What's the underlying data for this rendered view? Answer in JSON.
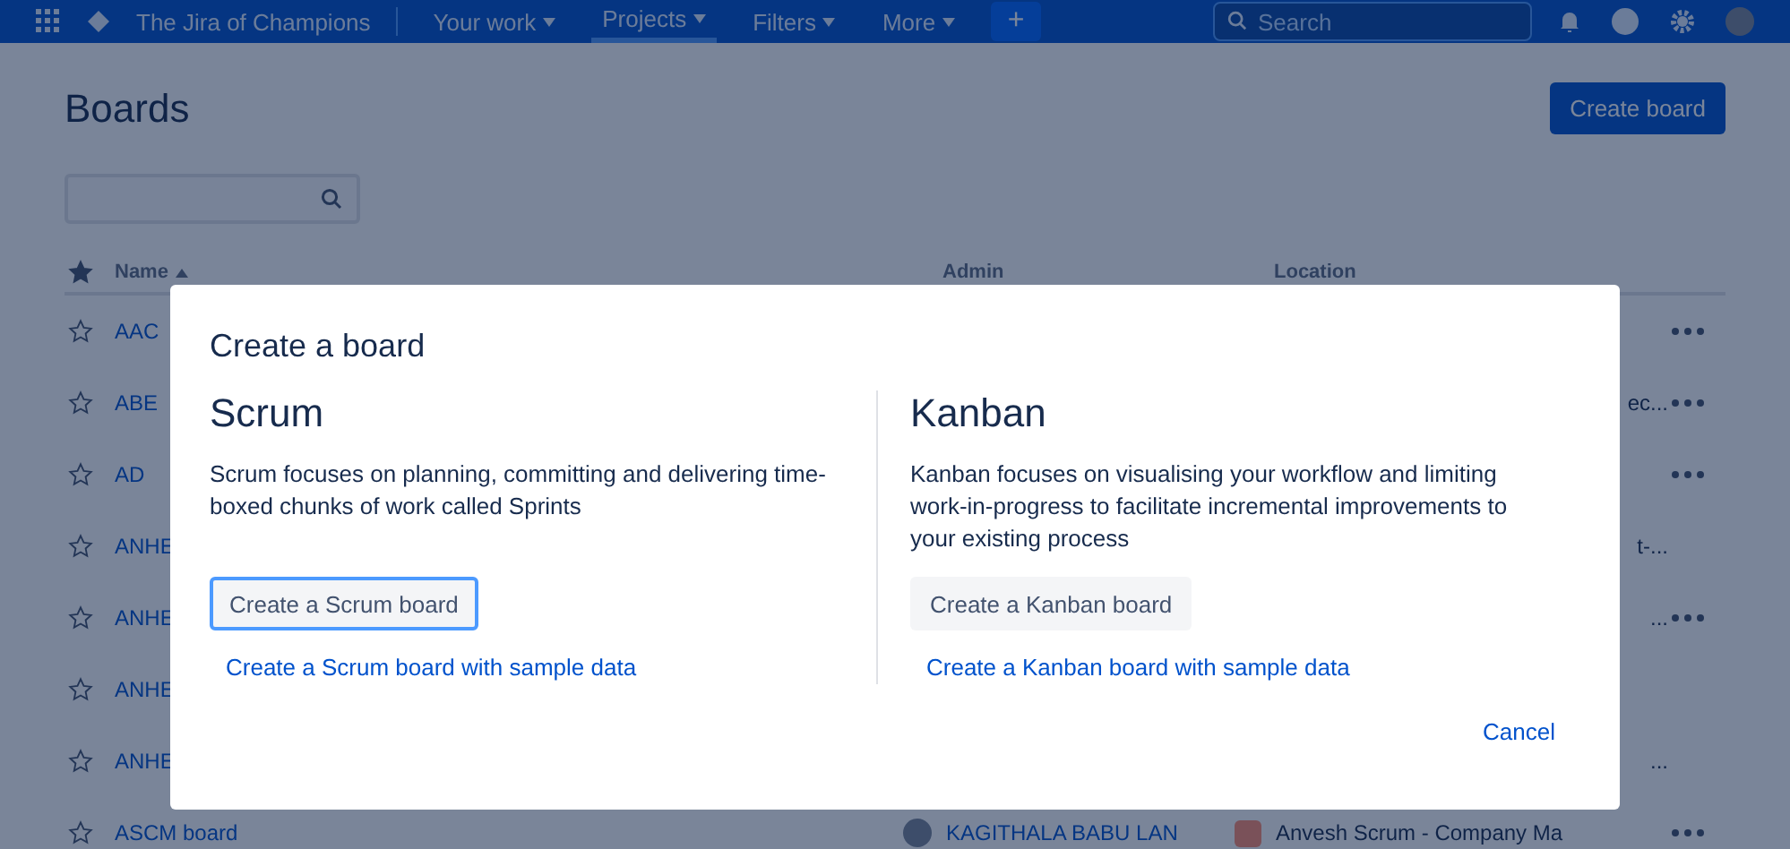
{
  "nav": {
    "site_title": "The Jira of Champions",
    "items": [
      {
        "label": "Your work",
        "selected": false
      },
      {
        "label": "Projects",
        "selected": true
      },
      {
        "label": "Filters",
        "selected": false
      },
      {
        "label": "More",
        "selected": false
      }
    ],
    "create": "+",
    "search": {
      "placeholder": "Search"
    }
  },
  "page": {
    "title": "Boards",
    "create_button": "Create board"
  },
  "table": {
    "columns": [
      "Name",
      "Admin",
      "Location"
    ],
    "rows": [
      {
        "name": "AAC",
        "admin": "",
        "location": "",
        "menu": true
      },
      {
        "name": "ABE",
        "admin": "",
        "location": "ec...",
        "menu": true
      },
      {
        "name": "AD",
        "admin": "",
        "location": "",
        "menu": true
      },
      {
        "name": "ANHE",
        "admin": "",
        "location": "t-...",
        "menu": false
      },
      {
        "name": "ANHE",
        "admin": "",
        "location": "...",
        "menu": true
      },
      {
        "name": "ANHE",
        "admin": "",
        "location": "",
        "menu": false
      },
      {
        "name": "ANHE",
        "admin": "",
        "location": "...",
        "menu": false
      },
      {
        "name": "ASCM board",
        "admin": "KAGITHALA BABU LAN",
        "location": "Anvesh Scrum - Company Ma",
        "menu": true
      }
    ]
  },
  "dialog": {
    "title": "Create a board",
    "options": [
      {
        "heading": "Scrum",
        "description": "Scrum focuses on planning, committing and delivering time-boxed chunks of work called Sprints",
        "button": "Create a Scrum board",
        "selected": true,
        "link": "Create a Scrum board with sample data"
      },
      {
        "heading": "Kanban",
        "description": "Kanban focuses on visualising your workflow and limiting work-in-progress to facilitate incremental improvements to your existing process",
        "button": "Create a Kanban board",
        "selected": false,
        "link": "Create a Kanban board with sample data"
      }
    ],
    "cancel": "Cancel"
  }
}
